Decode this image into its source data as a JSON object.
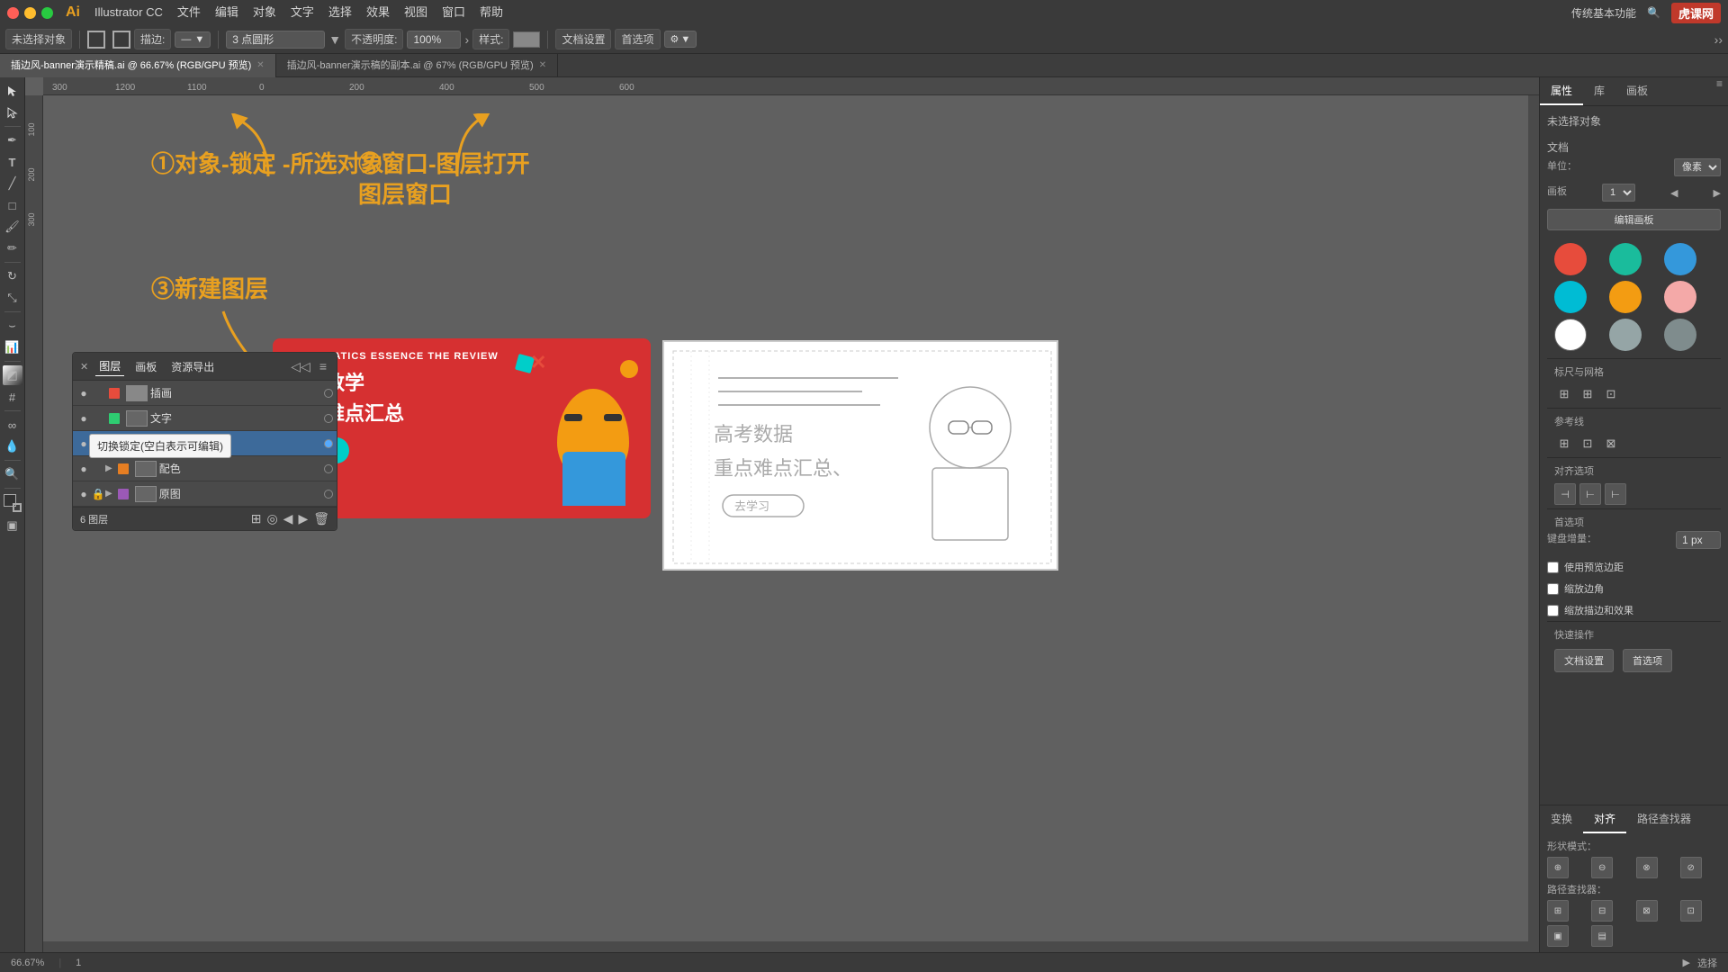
{
  "app": {
    "name": "Illustrator CC",
    "logo": "Ai",
    "version": "66.67%"
  },
  "menubar": {
    "mac_buttons": [
      "red",
      "yellow",
      "green"
    ],
    "menus": [
      "文件",
      "编辑",
      "对象",
      "文字",
      "选择",
      "效果",
      "视图",
      "窗口",
      "帮助"
    ],
    "right_label": "传统基本功能",
    "site": "虎课网"
  },
  "toolbar": {
    "no_select": "未选择对象",
    "stroke_label": "描边:",
    "shape_label": "3 点圆形",
    "opacity_label": "不透明度:",
    "opacity_value": "100%",
    "style_label": "样式:",
    "doc_settings": "文档设置",
    "preferences": "首选项"
  },
  "tabs": [
    {
      "label": "插边风-banner演示精稿.ai @ 66.67% (RGB/GPU 预览)",
      "active": true
    },
    {
      "label": "插边风-banner演示稿的副本.ai @ 67% (RGB/GPU 预览)",
      "active": false
    }
  ],
  "annotations": {
    "step1": "①对象-锁定\n-所选对象",
    "step2": "②窗口-图层打开\n图层窗口",
    "step3": "③新建图层"
  },
  "layers_panel": {
    "title": "图层",
    "tabs": [
      "图层",
      "画板",
      "资源导出"
    ],
    "layers": [
      {
        "name": "插画",
        "visible": true,
        "locked": false,
        "color": "#e74c3c"
      },
      {
        "name": "文字",
        "visible": true,
        "locked": false,
        "color": "#2ecc71"
      },
      {
        "name": "",
        "visible": true,
        "locked": false,
        "color": "#3498db",
        "editing": true
      },
      {
        "name": "配色",
        "visible": true,
        "locked": false,
        "color": "#e67e22",
        "expanded": true
      },
      {
        "name": "原图",
        "visible": true,
        "locked": true,
        "color": "#9b59b6"
      }
    ],
    "footer": {
      "count": "6 图层",
      "icons": [
        "new_layer",
        "delete",
        "options"
      ]
    }
  },
  "tooltip": {
    "text": "切换锁定(空白表示可编辑)"
  },
  "right_panel": {
    "tabs": [
      "属性",
      "库",
      "画板"
    ],
    "no_selection": "未选择对象",
    "doc_section": "文档",
    "units_label": "单位：",
    "units_value": "像素",
    "artboard_label": "画板",
    "artboard_value": "1",
    "edit_artboard_btn": "编辑画板",
    "rulers_label": "标尺与网格",
    "guides_label": "参考线",
    "align_label": "对齐选项",
    "prefs_label": "首选项",
    "keyboard_increment": "键盘增量：",
    "keyboard_value": "1 px",
    "use_preview_bounds": "使用预览边距",
    "use_round_corners": "缩放边角",
    "scale_strokes": "缩放描边和效果",
    "quick_actions": "快速操作",
    "doc_settings_btn": "文档设置",
    "preferences_btn": "首选项",
    "swatches": [
      {
        "color": "#e74c3c",
        "name": "red"
      },
      {
        "color": "#1abc9c",
        "name": "teal"
      },
      {
        "color": "#3498db",
        "name": "blue"
      },
      {
        "color": "#00bcd4",
        "name": "cyan"
      },
      {
        "color": "#f39c12",
        "name": "orange"
      },
      {
        "color": "#f4a9a8",
        "name": "pink"
      },
      {
        "color": "#ffffff",
        "name": "white"
      },
      {
        "color": "#95a5a6",
        "name": "gray"
      },
      {
        "color": "#7f8c8d",
        "name": "dark-gray"
      }
    ],
    "bottom_tabs": [
      "变换",
      "对齐",
      "路径查找器"
    ],
    "shape_modes_label": "形状模式：",
    "pathfinder_label": "路径查找器："
  },
  "statusbar": {
    "zoom": "66.67%",
    "artboard": "1",
    "tool": "选择"
  },
  "banner": {
    "subtitle": "MATHEMATICS ESSENCE THE REVIEW",
    "title_line1": "高考数学",
    "title_line2": "重点难点汇总",
    "cta": "去学习"
  }
}
